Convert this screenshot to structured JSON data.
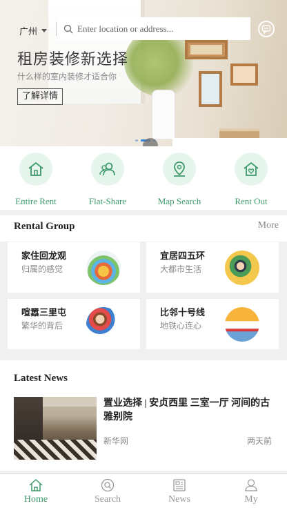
{
  "header": {
    "city": "广州",
    "search_placeholder": "Enter location or address...",
    "message_icon": "chat-bubble-icon"
  },
  "banner": {
    "title": "租房装修新选择",
    "subtitle": "什么样的室内装修才适合你",
    "button_label": "了解详情",
    "slide_count": 3,
    "active_slide": 1
  },
  "quick_nav": [
    {
      "label": "Entire Rent",
      "icon": "house-icon"
    },
    {
      "label": "Flat-Share",
      "icon": "people-icon"
    },
    {
      "label": "Map Search",
      "icon": "map-pin-icon"
    },
    {
      "label": "Rent Out",
      "icon": "house-heart-icon"
    }
  ],
  "rental_group": {
    "title": "Rental Group",
    "more_label": "More",
    "cards": [
      {
        "title": "家住回龙观",
        "subtitle": "归属的感觉",
        "icon": "buildings-icon"
      },
      {
        "title": "宜居四五环",
        "subtitle": "大都市生活",
        "icon": "commuter-icon"
      },
      {
        "title": "喧嚣三里屯",
        "subtitle": "繁华的背后",
        "icon": "friends-icon"
      },
      {
        "title": "比邻十号线",
        "subtitle": "地铁心连心",
        "icon": "train-icon"
      }
    ]
  },
  "news": {
    "title": "Latest News",
    "items": [
      {
        "title": "置业选择 | 安贞西里 三室一厅 河间的古雅别院",
        "source": "新华网",
        "time": "两天前"
      }
    ]
  },
  "tabbar": [
    {
      "label": "Home",
      "icon": "home-icon",
      "active": true
    },
    {
      "label": "Search",
      "icon": "search-icon",
      "active": false
    },
    {
      "label": "News",
      "icon": "newspaper-icon",
      "active": false
    },
    {
      "label": "My",
      "icon": "user-icon",
      "active": false
    }
  ],
  "colors": {
    "accent": "#3e9b6c",
    "icon_bg": "#e6f5ec",
    "dot_active": "#2f7fd6"
  }
}
